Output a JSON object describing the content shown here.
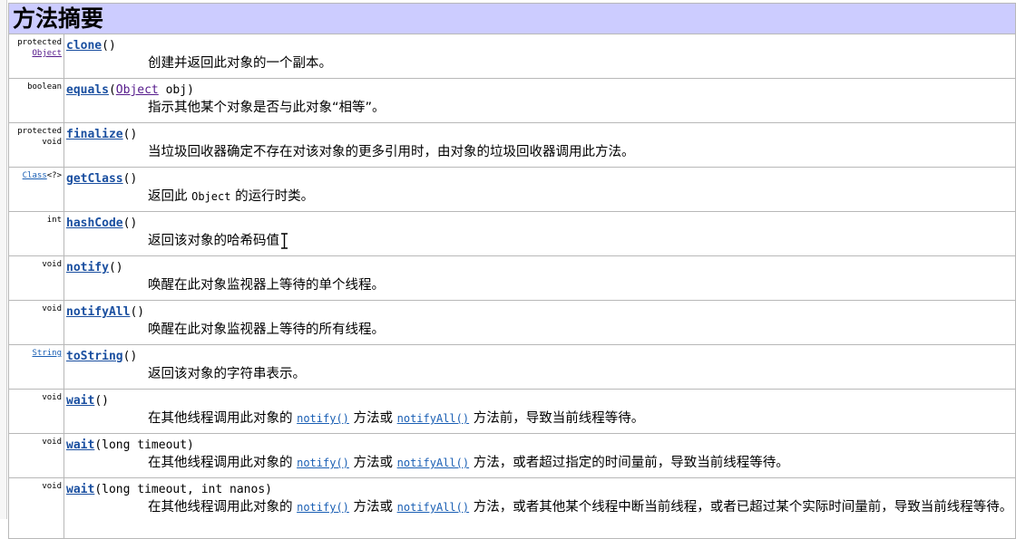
{
  "title": "方法摘要",
  "methods": [
    {
      "mod1": "protected",
      "mod2": "Object",
      "name": "clone",
      "params": "()",
      "desc": "创建并返回此对象的一个副本。"
    },
    {
      "mod1": "boolean",
      "name": "equals",
      "params_open": "(",
      "param_type": "Object",
      "params_rest": " obj)",
      "desc": "指示其他某个对象是否与此对象“相等”。"
    },
    {
      "mod1": "protected",
      "mod2": "void",
      "name": "finalize",
      "params": "()",
      "desc": "当垃圾回收器确定不存在对该对象的更多引用时，由对象的垃圾回收器调用此方法。"
    },
    {
      "mod_link": "Class",
      "mod_rest": "<?>",
      "name": "getClass",
      "params": "()",
      "desc_pre": "返回此 ",
      "desc_code": "Object",
      "desc_post": " 的运行时类。"
    },
    {
      "mod1": "int",
      "name": "hashCode",
      "params": "()",
      "desc": "返回该对象的哈希码值"
    },
    {
      "mod1": "void",
      "name": "notify",
      "params": "()",
      "desc": "唤醒在此对象监视器上等待的单个线程。"
    },
    {
      "mod1": "void",
      "name": "notifyAll",
      "params": "()",
      "desc": "唤醒在此对象监视器上等待的所有线程。"
    },
    {
      "mod_link": "String",
      "name": "toString",
      "params": "()",
      "desc": "返回该对象的字符串表示。"
    },
    {
      "mod1": "void",
      "name": "wait",
      "params": "()",
      "d1": "在其他线程调用此对象的 ",
      "l1": "notify()",
      "d2": " 方法或 ",
      "l2": "notifyAll()",
      "d3": " 方法前，导致当前线程等待。"
    },
    {
      "mod1": "void",
      "name": "wait",
      "params": "(long timeout)",
      "d1": "在其他线程调用此对象的 ",
      "l1": "notify()",
      "d2": " 方法或 ",
      "l2": "notifyAll()",
      "d3": " 方法，或者超过指定的时间量前，导致当前线程等待。"
    },
    {
      "mod1": "void",
      "name": "wait",
      "params": "(long timeout, int nanos)",
      "d1": "在其他线程调用此对象的 ",
      "l1": "notify()",
      "d2": " 方法或 ",
      "l2": "notifyAll()",
      "d3": " 方法，或者其他某个线程中断当前线程，或者已超过某个实际时间量前，导致当前线程等待。"
    }
  ]
}
